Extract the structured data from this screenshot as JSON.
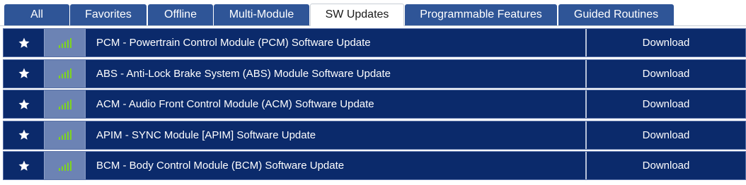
{
  "tabs": [
    {
      "label": "All",
      "active": false
    },
    {
      "label": "Favorites",
      "active": false
    },
    {
      "label": "Offline",
      "active": false
    },
    {
      "label": "Multi-Module",
      "active": false
    },
    {
      "label": "SW Updates",
      "active": true
    },
    {
      "label": "Programmable Features",
      "active": false
    },
    {
      "label": "Guided Routines",
      "active": false
    }
  ],
  "rows": [
    {
      "name": "PCM - Powertrain Control Module (PCM) Software Update",
      "action": "Download",
      "icon": "star-icon",
      "status_icon": "signal-bars-icon"
    },
    {
      "name": "ABS - Anti-Lock Brake System (ABS) Module Software Update",
      "action": "Download",
      "icon": "star-icon",
      "status_icon": "signal-bars-icon"
    },
    {
      "name": "ACM - Audio Front Control Module (ACM) Software Update",
      "action": "Download",
      "icon": "star-icon",
      "status_icon": "signal-bars-icon"
    },
    {
      "name": "APIM - SYNC Module [APIM] Software Update",
      "action": "Download",
      "icon": "star-icon",
      "status_icon": "signal-bars-icon"
    },
    {
      "name": "BCM - Body Control Module (BCM) Software Update",
      "action": "Download",
      "icon": "star-icon",
      "status_icon": "signal-bars-icon"
    }
  ],
  "colors": {
    "tab_bg": "#2f5597",
    "row_bg": "#0b2a6b",
    "signal_cell_bg": "#6c83b4",
    "signal_green": "#7ed321"
  }
}
